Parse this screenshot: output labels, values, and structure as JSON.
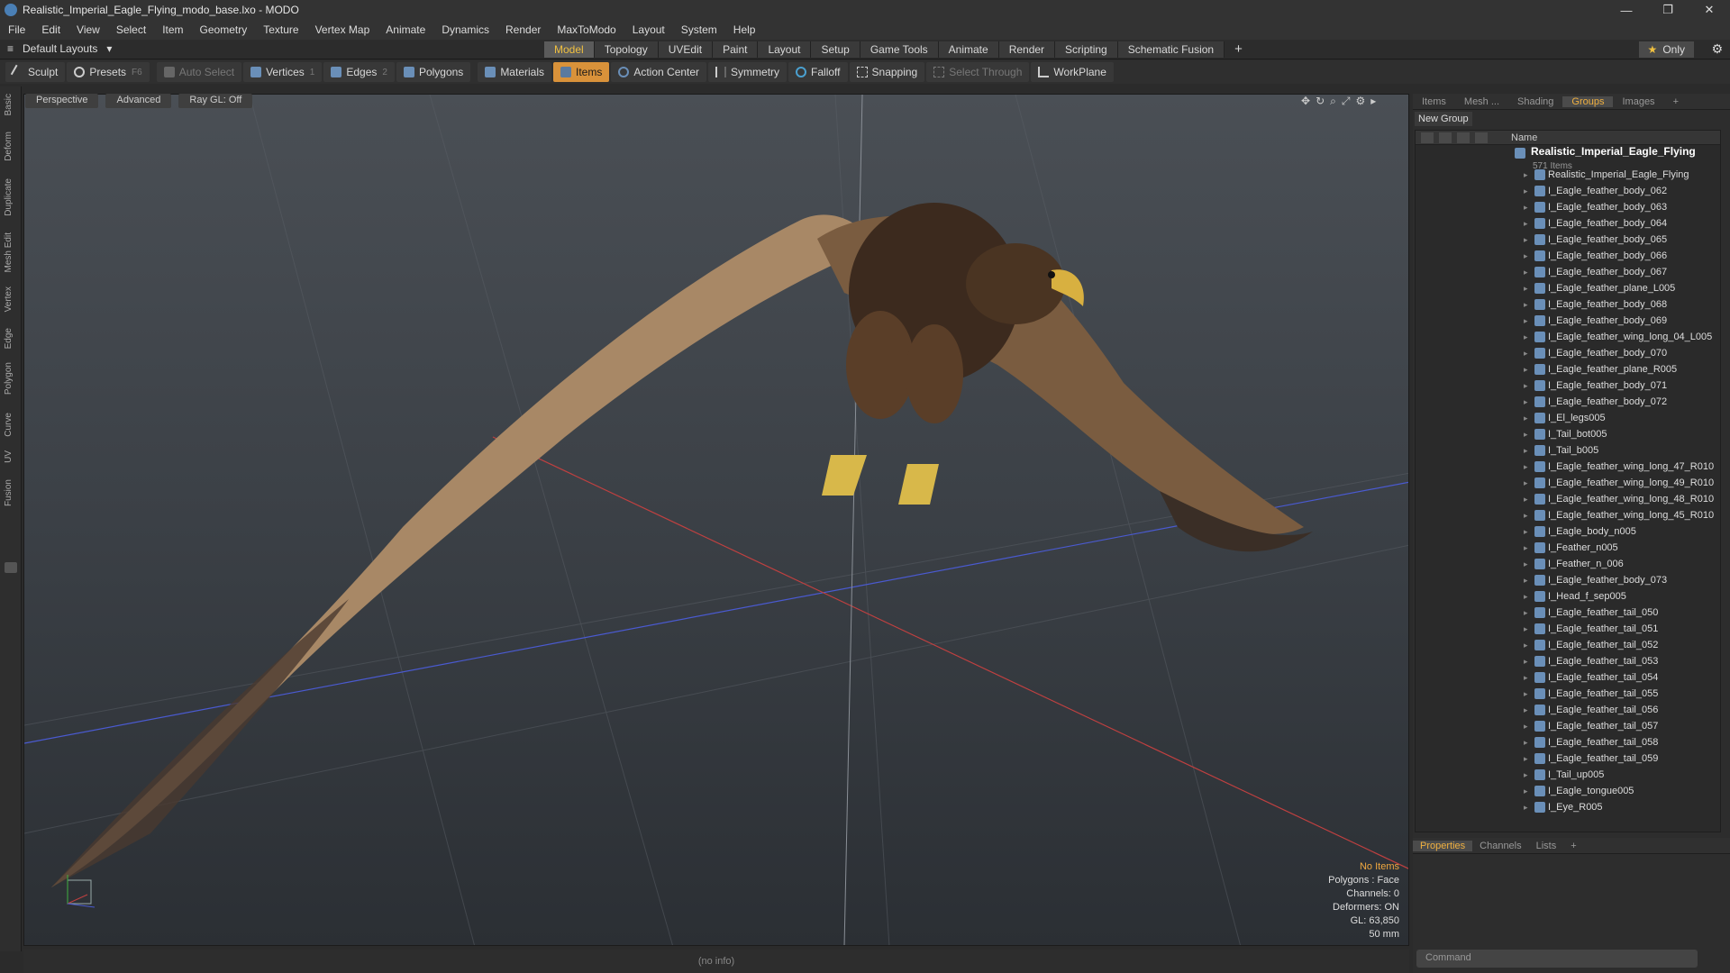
{
  "window": {
    "title": "Realistic_Imperial_Eagle_Flying_modo_base.lxo - MODO"
  },
  "menu": [
    "File",
    "Edit",
    "View",
    "Select",
    "Item",
    "Geometry",
    "Texture",
    "Vertex Map",
    "Animate",
    "Dynamics",
    "Render",
    "MaxToModo",
    "Layout",
    "System",
    "Help"
  ],
  "layouts": {
    "label": "Default Layouts"
  },
  "mode_tabs": [
    "Model",
    "Topology",
    "UVEdit",
    "Paint",
    "Layout",
    "Setup",
    "Game Tools",
    "Animate",
    "Render",
    "Scripting",
    "Schematic Fusion"
  ],
  "only_label": "Only",
  "toolbar": {
    "sculpt": "Sculpt",
    "presets": "Presets",
    "presets_key": "F6",
    "auto_select": "Auto Select",
    "vertices": "Vertices",
    "vertices_key": "1",
    "edges": "Edges",
    "edges_key": "2",
    "polygons": "Polygons",
    "materials": "Materials",
    "items": "Items",
    "action_center": "Action Center",
    "symmetry": "Symmetry",
    "falloff": "Falloff",
    "snapping": "Snapping",
    "select_through": "Select Through",
    "workplane": "WorkPlane"
  },
  "left_tabs": [
    "Basic",
    "Deform",
    "Duplicate",
    "Mesh Edit",
    "Vertex",
    "Edge",
    "Polygon",
    "Curve",
    "UV",
    "Fusion"
  ],
  "viewport": {
    "view": "Perspective",
    "shading": "Advanced",
    "raygl": "Ray GL: Off",
    "info": {
      "items": "No Items",
      "polygons": "Polygons : Face",
      "channels": "Channels: 0",
      "deformers": "Deformers: ON",
      "gl": "GL: 63,850",
      "lens": "50 mm"
    }
  },
  "panel": {
    "tabs": [
      "Items",
      "Mesh ...",
      "Shading",
      "Groups",
      "Images"
    ],
    "new_group": "New Group",
    "name_col": "Name",
    "group_name": "Realistic_Imperial_Eagle_Flying",
    "group_count": "571 Items",
    "rows": [
      "Realistic_Imperial_Eagle_Flying",
      "I_Eagle_feather_body_062",
      "I_Eagle_feather_body_063",
      "I_Eagle_feather_body_064",
      "I_Eagle_feather_body_065",
      "I_Eagle_feather_body_066",
      "I_Eagle_feather_body_067",
      "I_Eagle_feather_plane_L005",
      "I_Eagle_feather_body_068",
      "I_Eagle_feather_body_069",
      "I_Eagle_feather_wing_long_04_L005",
      "I_Eagle_feather_body_070",
      "I_Eagle_feather_plane_R005",
      "I_Eagle_feather_body_071",
      "I_Eagle_feather_body_072",
      "I_El_legs005",
      "I_Tail_bot005",
      "I_Tail_b005",
      "I_Eagle_feather_wing_long_47_R010",
      "I_Eagle_feather_wing_long_49_R010",
      "I_Eagle_feather_wing_long_48_R010",
      "I_Eagle_feather_wing_long_45_R010",
      "I_Eagle_body_n005",
      "I_Feather_n005",
      "I_Feather_n_006",
      "I_Eagle_feather_body_073",
      "I_Head_f_sep005",
      "I_Eagle_feather_tail_050",
      "I_Eagle_feather_tail_051",
      "I_Eagle_feather_tail_052",
      "I_Eagle_feather_tail_053",
      "I_Eagle_feather_tail_054",
      "I_Eagle_feather_tail_055",
      "I_Eagle_feather_tail_056",
      "I_Eagle_feather_tail_057",
      "I_Eagle_feather_tail_058",
      "I_Eagle_feather_tail_059",
      "I_Tail_up005",
      "I_Eagle_tongue005",
      "I_Eye_R005"
    ],
    "bottom_tabs": [
      "Properties",
      "Channels",
      "Lists"
    ]
  },
  "status": {
    "text": "(no info)"
  },
  "command": {
    "placeholder": "Command"
  }
}
